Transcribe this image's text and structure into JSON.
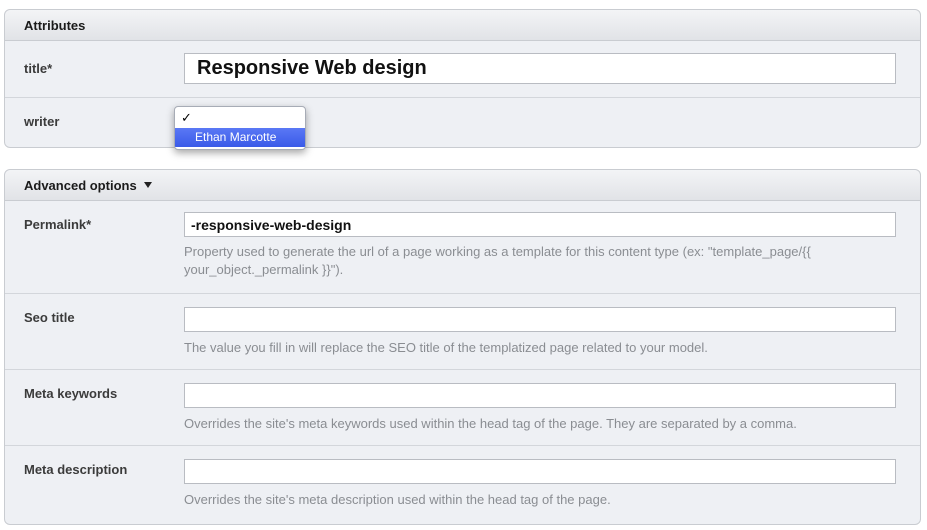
{
  "attributes": {
    "heading": "Attributes",
    "title_label": "title*",
    "title_value": "Responsive Web design",
    "writer_label": "writer",
    "writer_dropdown": {
      "check_mark": "✓",
      "selected_option": "Ethan Marcotte"
    }
  },
  "advanced": {
    "heading": "Advanced options",
    "permalink": {
      "label": "Permalink*",
      "value": "-responsive-web-design",
      "help": "Property used to generate the url of a page working as a template for this content type (ex: \"template_page/{{ your_object._permalink }}\")."
    },
    "seo_title": {
      "label": "Seo title",
      "value": "",
      "help": "The value you fill in will replace the SEO title of the templatized page related to your model."
    },
    "meta_keywords": {
      "label": "Meta keywords",
      "value": "",
      "help": "Overrides the site's meta keywords used within the head tag of the page. They are separated by a comma."
    },
    "meta_description": {
      "label": "Meta description",
      "value": "",
      "help": "Overrides the site's meta description used within the head tag of the page."
    }
  }
}
